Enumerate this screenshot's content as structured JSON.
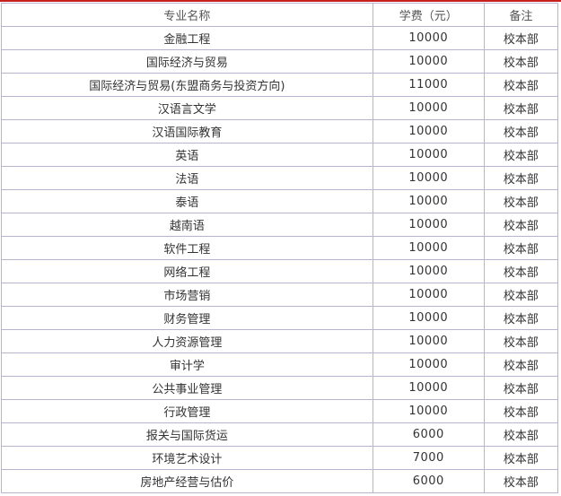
{
  "table": {
    "headers": {
      "major": "专业名称",
      "fee": "学费（元）",
      "note": "备注"
    },
    "rows": [
      {
        "major": "金融工程",
        "fee": "10000",
        "note": "校本部"
      },
      {
        "major": "国际经济与贸易",
        "fee": "10000",
        "note": "校本部"
      },
      {
        "major": "国际经济与贸易(东盟商务与投资方向)",
        "fee": "11000",
        "note": "校本部"
      },
      {
        "major": "汉语言文学",
        "fee": "10000",
        "note": "校本部"
      },
      {
        "major": "汉语国际教育",
        "fee": "10000",
        "note": "校本部"
      },
      {
        "major": "英语",
        "fee": "10000",
        "note": "校本部"
      },
      {
        "major": "法语",
        "fee": "10000",
        "note": "校本部"
      },
      {
        "major": "泰语",
        "fee": "10000",
        "note": "校本部"
      },
      {
        "major": "越南语",
        "fee": "10000",
        "note": "校本部"
      },
      {
        "major": "软件工程",
        "fee": "10000",
        "note": "校本部"
      },
      {
        "major": "网络工程",
        "fee": "10000",
        "note": "校本部"
      },
      {
        "major": "市场营销",
        "fee": "10000",
        "note": "校本部"
      },
      {
        "major": "财务管理",
        "fee": "10000",
        "note": "校本部"
      },
      {
        "major": "人力资源管理",
        "fee": "10000",
        "note": "校本部"
      },
      {
        "major": "审计学",
        "fee": "10000",
        "note": "校本部"
      },
      {
        "major": "公共事业管理",
        "fee": "10000",
        "note": "校本部"
      },
      {
        "major": "行政管理",
        "fee": "10000",
        "note": "校本部"
      },
      {
        "major": "报关与国际货运",
        "fee": "6000",
        "note": "校本部"
      },
      {
        "major": "环境艺术设计",
        "fee": "7000",
        "note": "校本部"
      },
      {
        "major": "房地产经营与估价",
        "fee": "6000",
        "note": "校本部"
      }
    ]
  }
}
